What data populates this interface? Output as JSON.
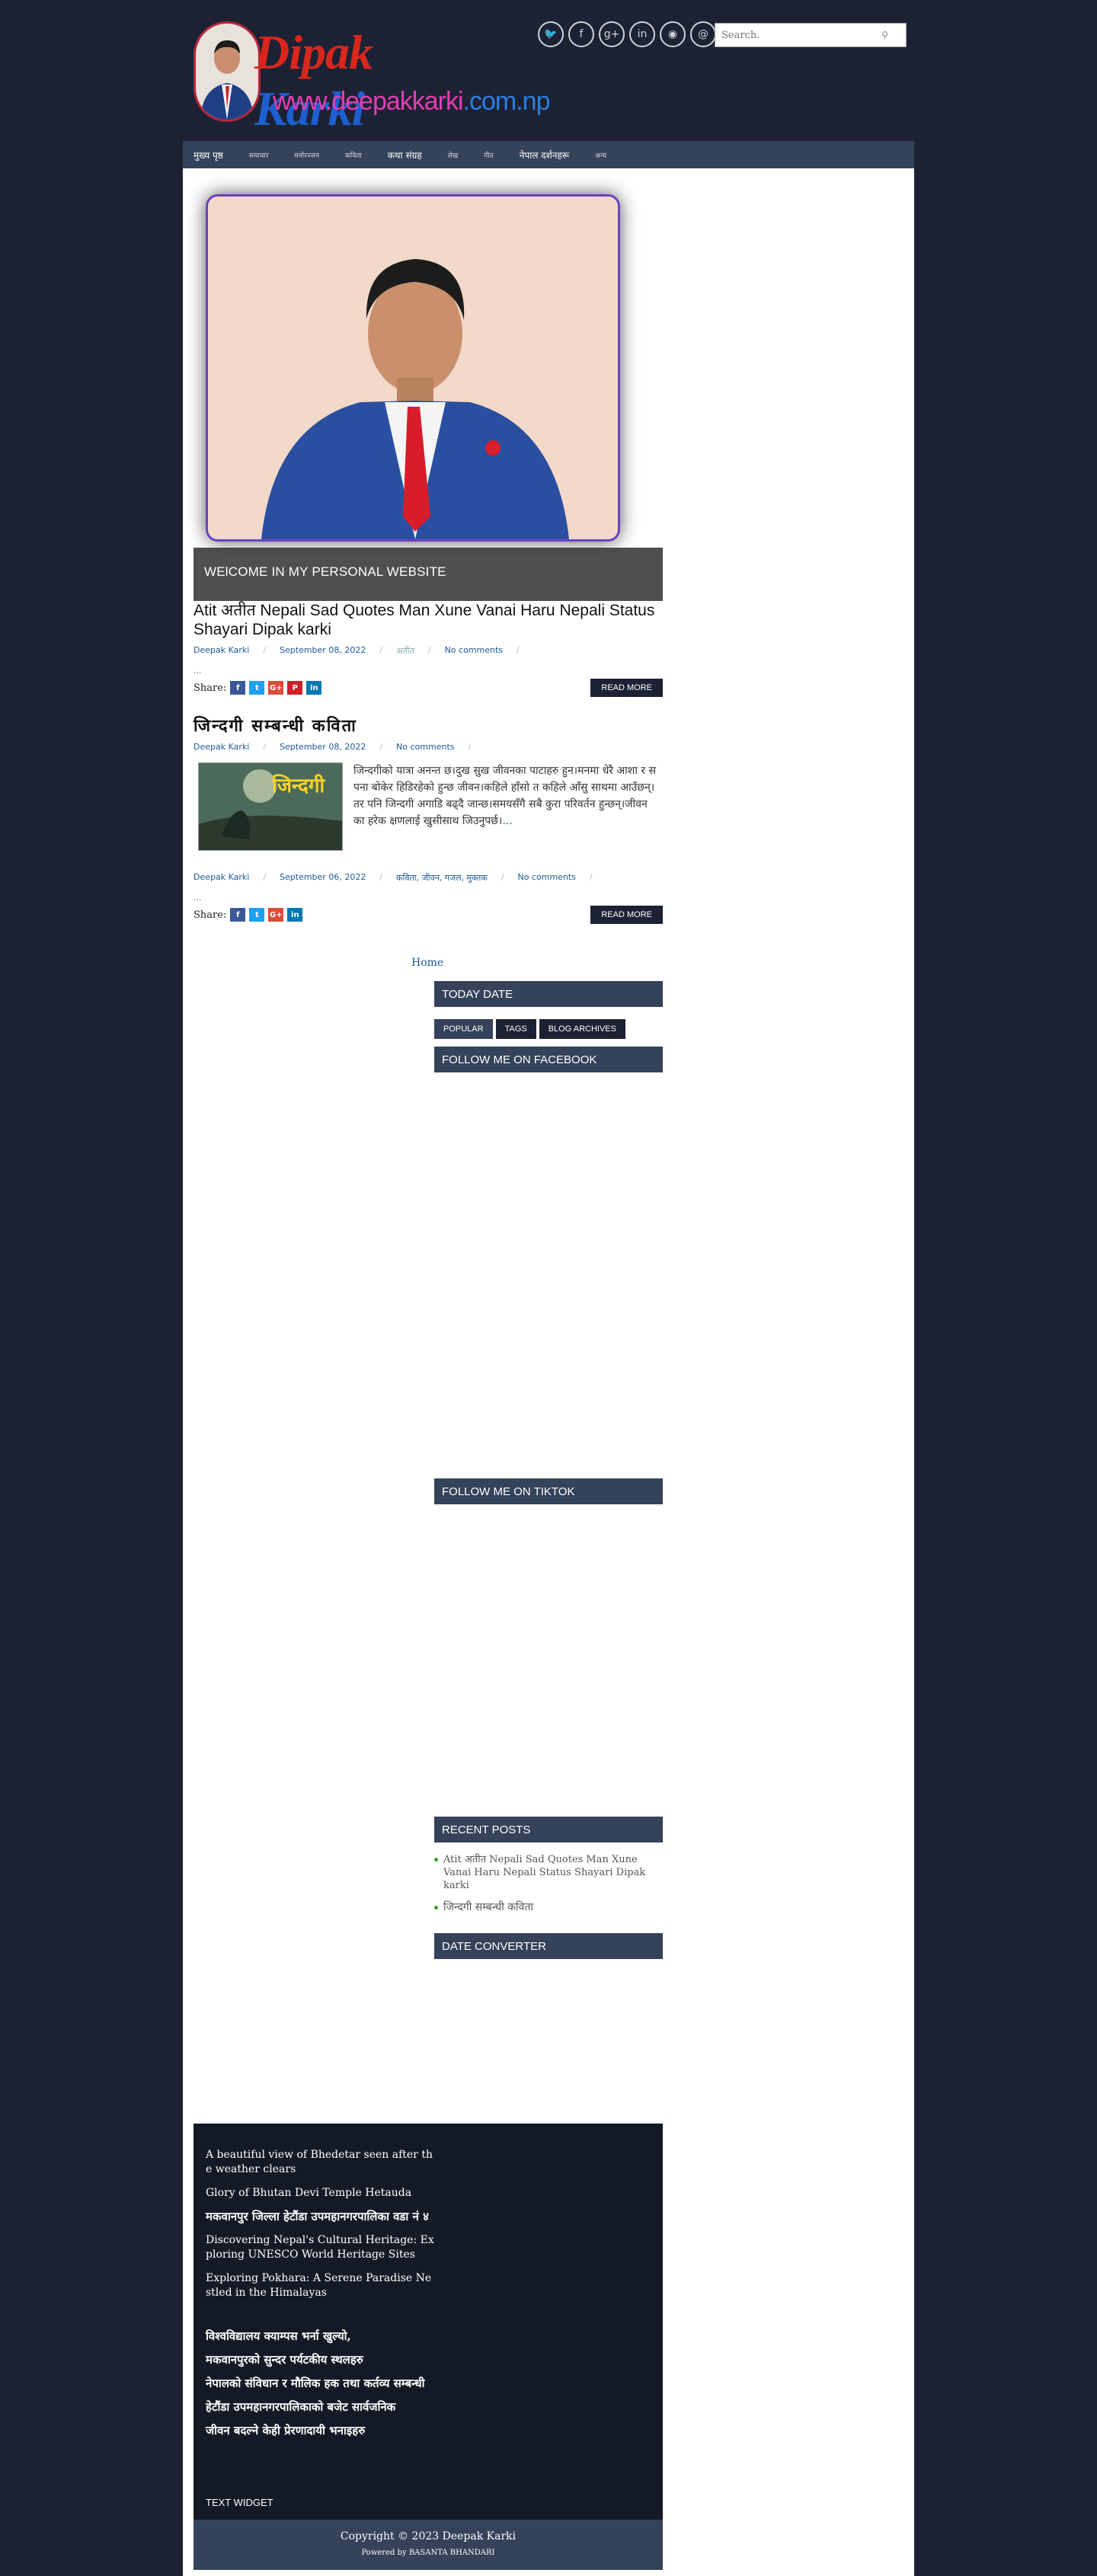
{
  "header": {
    "logo_title_first": "Di",
    "logo_title_mid": "pak",
    "logo_title_last": " Karki",
    "logo_url_main": "www.deepakkarki",
    "logo_url_tld": ".com.np",
    "social_icons": [
      "twitter-icon",
      "facebook-icon",
      "google-plus-icon",
      "linkedin-icon",
      "rss-icon",
      "email-icon"
    ],
    "search_placeholder": "Search."
  },
  "nav": {
    "items": [
      "मुख्य पृष्ठ",
      "समाचार",
      "मनोरञ्जन",
      "कविता",
      "कथा संग्रह",
      "लेख",
      "गीत",
      "नेपाल दर्शनहरू",
      "अन्य"
    ]
  },
  "hero": {
    "caption": "WElCOME IN MY PERSONAL WEBSITE"
  },
  "posts": [
    {
      "title": "Atit अतीत Nepali Sad Quotes Man Xune Vanai Haru Nepali Status Shayari Dipak karki",
      "author": "Deepak Karki",
      "date": "September 08, 2022",
      "label": "अतीत",
      "comments": "No comments",
      "dots": "...",
      "share_label": "Share:",
      "read_more": "READ MORE"
    },
    {
      "title": "जिन्दगी सम्बन्धी कविता",
      "author": "Deepak Karki",
      "date": "September 08, 2022",
      "comments": "No comments",
      "thumb_title": "जिन्दगी",
      "excerpt": "जिन्दगीको यात्रा अनन्त छ।दुख सुख जीवनका पाटाहरु हुन।मनमा धेरै आशा र सपना बोकेर हिडिरहेको हुन्छ जीवन।कहिले हाँसो त कहिले आँसु साथमा आउँछन्। तर पनि जिन्दगी अगाडि बढ्दै जान्छ।समयसँगै सबै कुरा परिवर्तन हुन्छन्।जीवनका हरेक क्षणलाई खुसीसाथ जिउनुपर्छ।",
      "excerpt_more": "...",
      "author2": "Deepak Karki",
      "date2": "September 06, 2022",
      "labels2": "कविता, जीवन, गजल, मुक्तक",
      "comments2": "No comments",
      "dots": "...",
      "share_label": "Share:",
      "read_more": "READ MORE"
    }
  ],
  "home_link": "Home",
  "sidebar": {
    "today_date": "TODAY DATE",
    "tabs": [
      "POPULAR",
      "TAGS",
      "BLOG ARCHIVES"
    ],
    "facebook": "FOLLOW ME ON FACEBOOK",
    "tiktok": "FOLLOW ME ON TIKTOK",
    "recent_posts": "RECENT POSTS",
    "recent_items": [
      "Atit अतीत Nepali Sad Quotes Man Xune Vanai Haru Nepali Status Shayari Dipak karki",
      "जिन्दगी सम्बन्धी कविता"
    ],
    "date_converter": "DATE CONVERTER"
  },
  "footer": {
    "links": [
      "A beautiful view of Bhedetar seen after the weather clears",
      "Glory of Bhutan Devi Temple Hetauda",
      "मकवानपुर जिल्ला हेटौंडा उपमहानगरपालिका वडा नं ४",
      "Discovering Nepal's Cultural Heritage: Exploring UNESCO World Heritage Sites",
      "Exploring Pokhara: A Serene Paradise Nestled in the Himalayas",
      "विश्वविद्यालय क्याम्पस भर्ना खुल्यो,",
      "मकवानपुरको सुन्दर पर्यटकीय स्थलहरु",
      "नेपालको संविधान र मौलिक हक तथा कर्तव्य सम्बन्धी",
      "हेटौंडा उपमहानगरपालिकाको बजेट सार्वजनिक",
      "जीवन बदल्ने केही प्रेरणादायी भनाइहरु"
    ],
    "text_widget": "TEXT WIDGET",
    "copyright": "Copyright © 2023 Deepak Karki",
    "powered": "Powered by BASANTA BHANDARI"
  },
  "colors": {
    "page_bg": "#1c2233",
    "nav_bg": "#34425a",
    "widget_head_bg": "#34425a",
    "link": "#1c5a99",
    "footer_bg": "#141a25"
  }
}
